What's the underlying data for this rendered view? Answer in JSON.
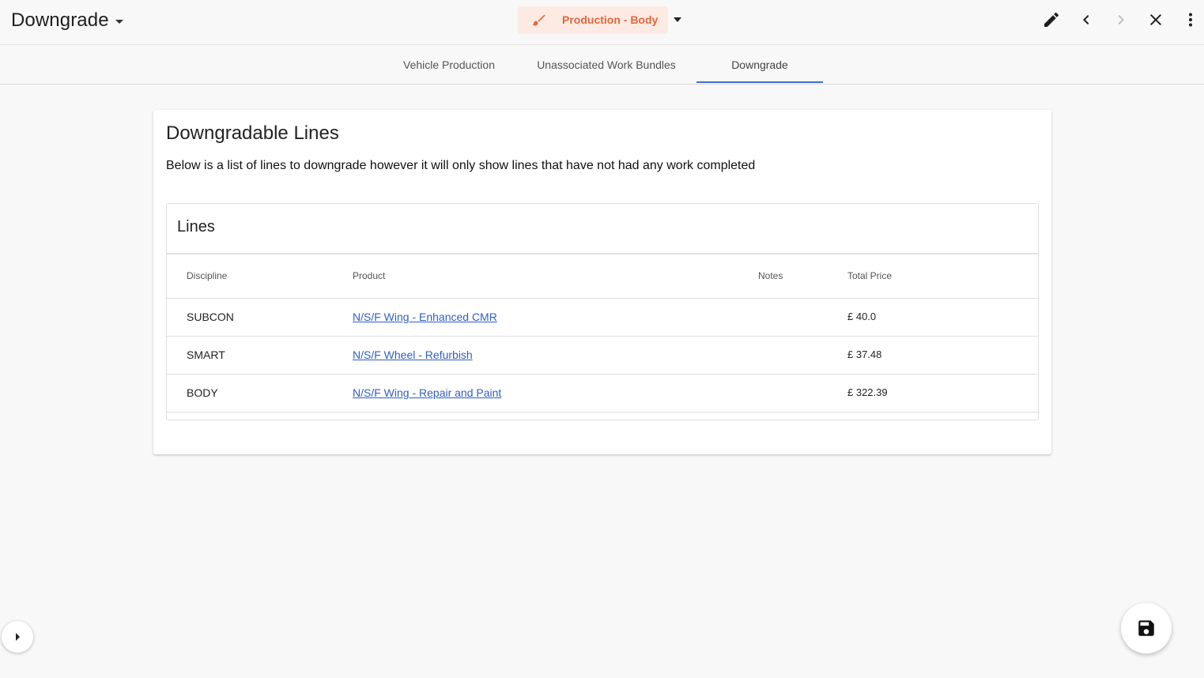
{
  "header": {
    "title": "Downgrade",
    "stage_label": "Production - Body",
    "accent_color": "#e2673f",
    "icons": [
      "edit-icon",
      "chevron-left-icon",
      "chevron-right-icon",
      "close-icon",
      "more-vert-icon"
    ]
  },
  "tabs": [
    {
      "label": "Vehicle Production",
      "active": false
    },
    {
      "label": "Unassociated Work Bundles",
      "active": false
    },
    {
      "label": "Downgrade",
      "active": true
    }
  ],
  "card": {
    "title": "Downgradable Lines",
    "description": "Below is a list of lines to downgrade however it will only show lines that have not had any work completed",
    "lines": {
      "title": "Lines",
      "columns": [
        "Discipline",
        "Product",
        "Notes",
        "Total Price"
      ],
      "rows": [
        {
          "discipline": "SUBCON",
          "product": "N/S/F Wing - Enhanced CMR",
          "notes": "",
          "total_price": "£ 40.0"
        },
        {
          "discipline": "SMART",
          "product": "N/S/F Wheel - Refurbish",
          "notes": "",
          "total_price": "£ 37.48"
        },
        {
          "discipline": "BODY",
          "product": "N/S/F Wing - Repair and Paint",
          "notes": "",
          "total_price": "£ 322.39"
        }
      ]
    }
  },
  "fab": {
    "icon": "save-icon"
  },
  "side_toggle": {
    "icon": "arrow-right-icon"
  }
}
